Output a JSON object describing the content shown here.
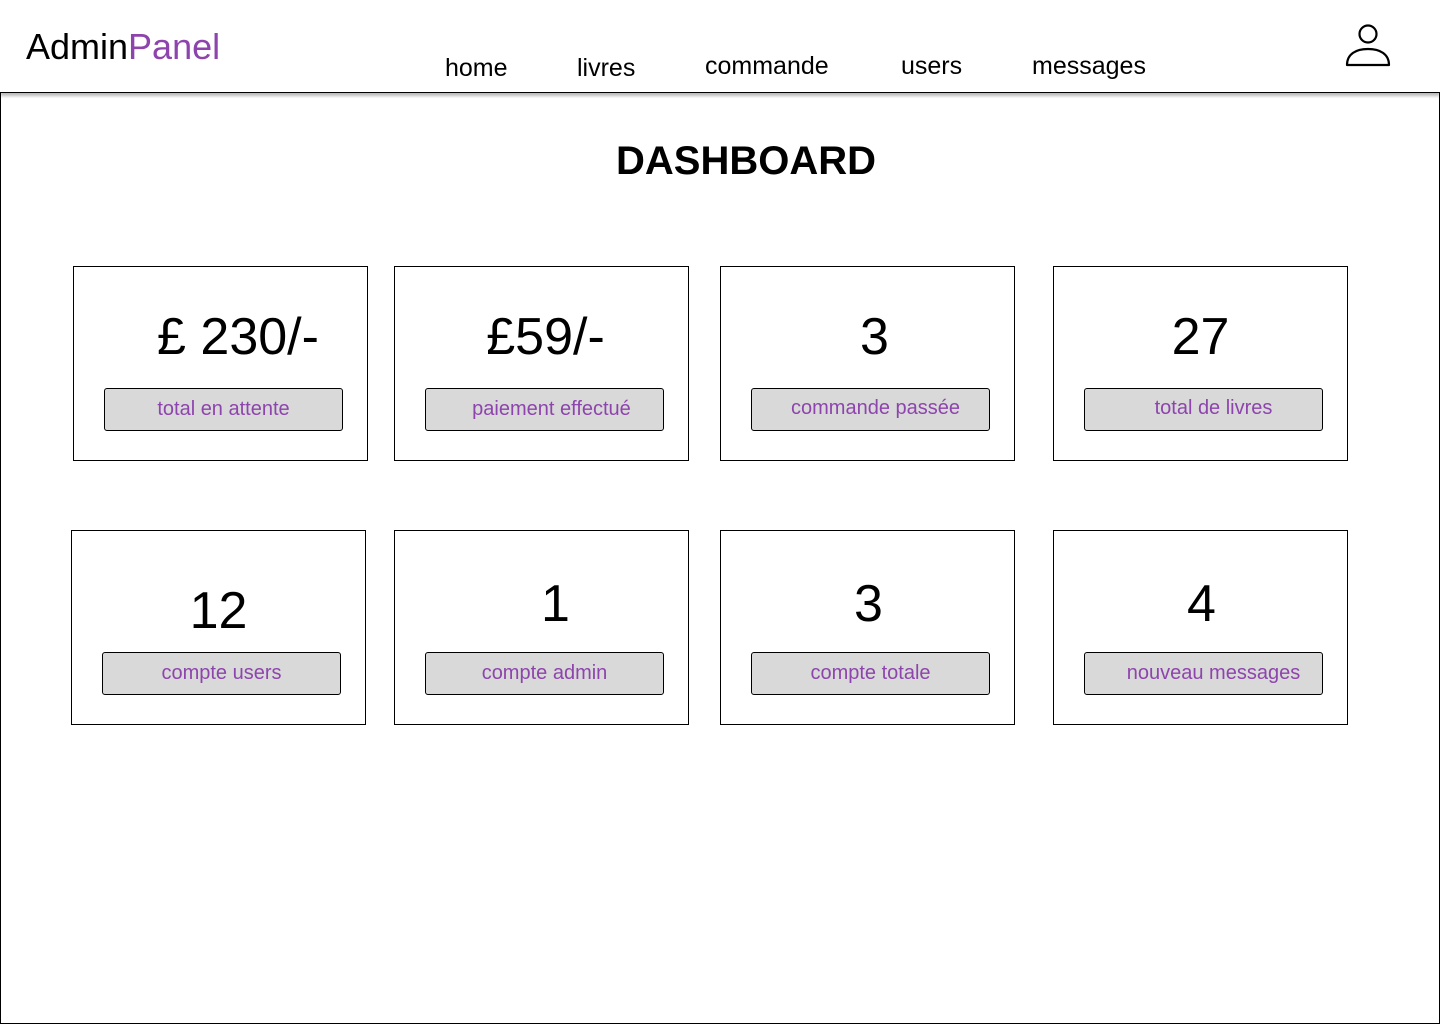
{
  "header": {
    "logo_main": "Admin",
    "logo_accent": "Panel",
    "accent_color": "#8e44ad",
    "nav": [
      {
        "label": "home"
      },
      {
        "label": "livres"
      },
      {
        "label": "commande"
      },
      {
        "label": "users"
      },
      {
        "label": "messages"
      }
    ],
    "account_icon": "user-icon"
  },
  "main": {
    "title": "DASHBOARD",
    "cards": [
      {
        "value": "£ 230/-",
        "label": "total en attente"
      },
      {
        "value": "£59/-",
        "label": "paiement effectué"
      },
      {
        "value": "3",
        "label": "commande passée"
      },
      {
        "value": "27",
        "label": "total de livres"
      },
      {
        "value": "12",
        "label": "compte users"
      },
      {
        "value": "1",
        "label": "compte admin"
      },
      {
        "value": "3",
        "label": "compte totale"
      },
      {
        "value": "4",
        "label": "nouveau messages"
      }
    ]
  }
}
